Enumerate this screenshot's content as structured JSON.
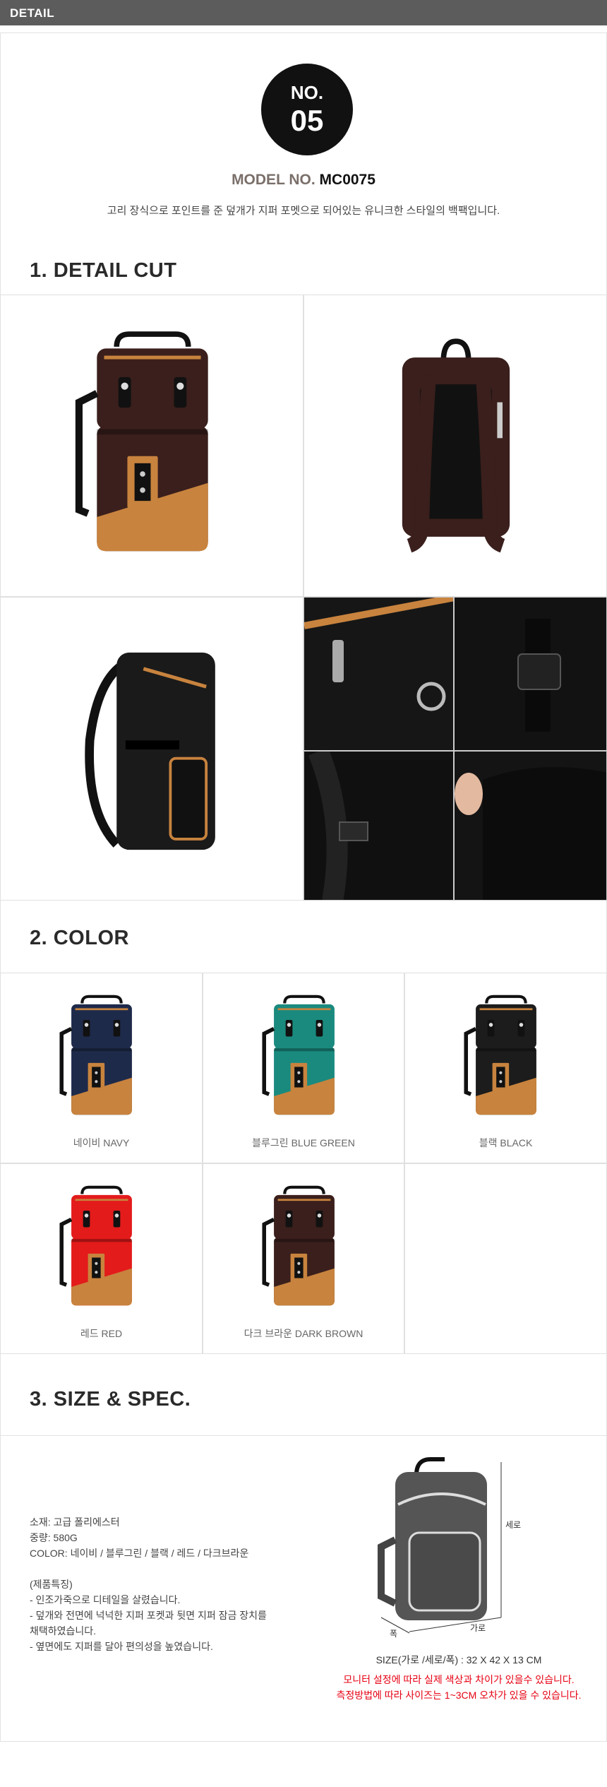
{
  "header": {
    "title": "DETAIL"
  },
  "badge": {
    "label": "NO.",
    "number": "05"
  },
  "model": {
    "label": "MODEL NO.",
    "code": "MC0075"
  },
  "description": "고리 장식으로 포인트를 준 덮개가 지퍼 포멧으로 되어있는 유니크한 스타일의 백팩입니다.",
  "sections": {
    "detail_cut": "1. DETAIL CUT",
    "color": "2. COLOR",
    "size_spec": "3. SIZE & SPEC."
  },
  "colors": [
    {
      "name": "네이비 NAVY",
      "hex": "#1e2a4a"
    },
    {
      "name": "블루그린 BLUE GREEN",
      "hex": "#1a8a7e"
    },
    {
      "name": "블랙 BLACK",
      "hex": "#1c1c1c"
    },
    {
      "name": "레드 RED",
      "hex": "#e31b1b"
    },
    {
      "name": "다크 브라운  DARK BROWN",
      "hex": "#3a1f1c"
    }
  ],
  "accent_tan": "#c8833e",
  "spec": {
    "material": "소재: 고급 폴리에스터",
    "weight": "중량: 580G",
    "colors": "COLOR: 네이비 / 블루그린 / 블랙 / 레드 / 다크브라운",
    "features_title": "(제품특징)",
    "features": [
      "- 인조가죽으로 디테일을 살렸습니다.",
      "- 덮개와 전면에 넉넉한 지퍼 포켓과 뒷면 지퍼 잠금 장치를",
      "채택하였습니다.",
      "- 옆면에도 지퍼를 달아 편의성을 높였습니다."
    ]
  },
  "size": {
    "label_height": "세로",
    "label_width": "가로",
    "label_depth": "폭",
    "line": "SIZE(가로 /세로/폭) : 32 X 42 X 13 CM",
    "warning1": "모니터 설정에 따라 실제 색상과 차이가 있을수 있습니다.",
    "warning2": "측정방법에 따라 사이즈는 1~3CM 오차가 있을 수 있습니다."
  }
}
